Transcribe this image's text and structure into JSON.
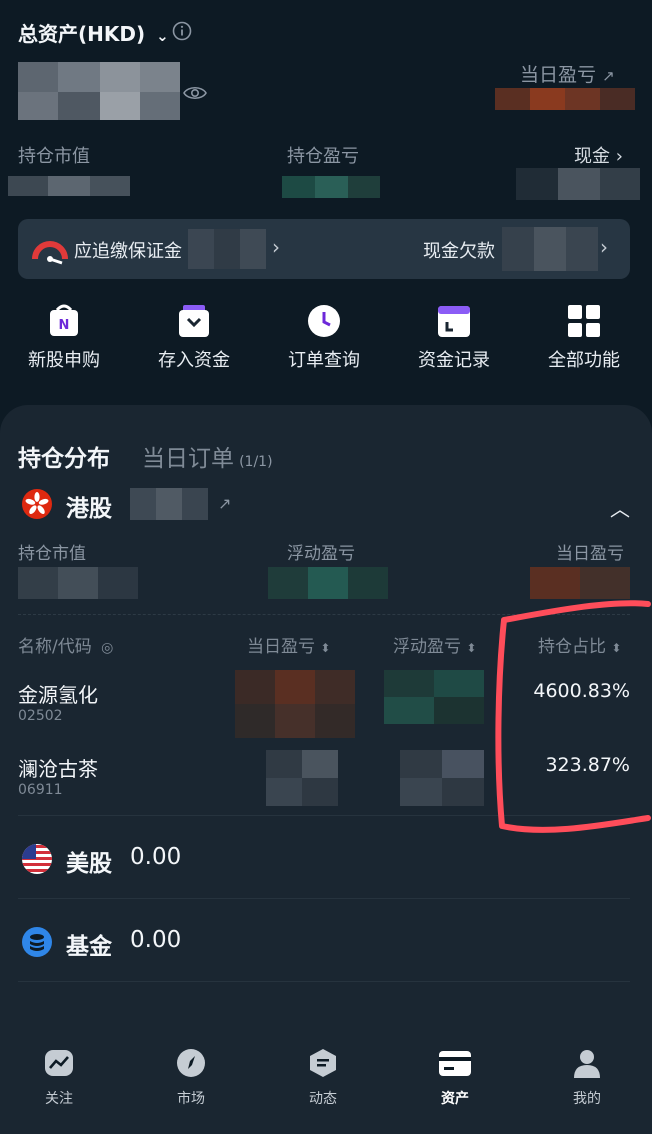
{
  "header": {
    "total_assets_label": "总资产(HKD)",
    "daily_pnl_label": "当日盈亏",
    "position_value_label": "持仓市值",
    "position_pnl_label": "持仓盈亏",
    "cash_label": "现金"
  },
  "alert": {
    "margin_call_label": "应追缴保证金",
    "cash_debt_label": "现金欠款"
  },
  "shortcuts": [
    {
      "label": "新股申购",
      "icon": "ipo-icon"
    },
    {
      "label": "存入资金",
      "icon": "deposit-icon"
    },
    {
      "label": "订单查询",
      "icon": "clock-icon"
    },
    {
      "label": "资金记录",
      "icon": "calendar-icon"
    },
    {
      "label": "全部功能",
      "icon": "grid-icon"
    }
  ],
  "tabs": {
    "holdings": "持仓分布",
    "orders": "当日订单",
    "orders_count": "(1/1)"
  },
  "hk": {
    "title": "港股",
    "position_value_label": "持仓市值",
    "floating_pnl_label": "浮动盈亏",
    "daily_pnl_label": "当日盈亏"
  },
  "table": {
    "col_name": "名称/代码",
    "col_daily_pnl": "当日盈亏",
    "col_floating_pnl": "浮动盈亏",
    "col_ratio": "持仓占比",
    "rows": [
      {
        "name": "金源氢化",
        "code": "02502",
        "ratio": "4600.83%"
      },
      {
        "name": "澜沧古茶",
        "code": "06911",
        "ratio": "323.87%"
      }
    ]
  },
  "us": {
    "title": "美股",
    "value": "0.00"
  },
  "fund": {
    "title": "基金",
    "value": "0.00"
  },
  "nav": [
    {
      "label": "关注",
      "icon": "chart-icon"
    },
    {
      "label": "市场",
      "icon": "compass-icon"
    },
    {
      "label": "动态",
      "icon": "feed-icon"
    },
    {
      "label": "资产",
      "icon": "wallet-icon"
    },
    {
      "label": "我的",
      "icon": "user-icon"
    }
  ],
  "colors": {
    "background": "#0d1a24",
    "panel": "#1a2631",
    "alert_bar": "#273643",
    "annotation": "#ff4d5a",
    "accent_purple": "#8b5cf6"
  }
}
